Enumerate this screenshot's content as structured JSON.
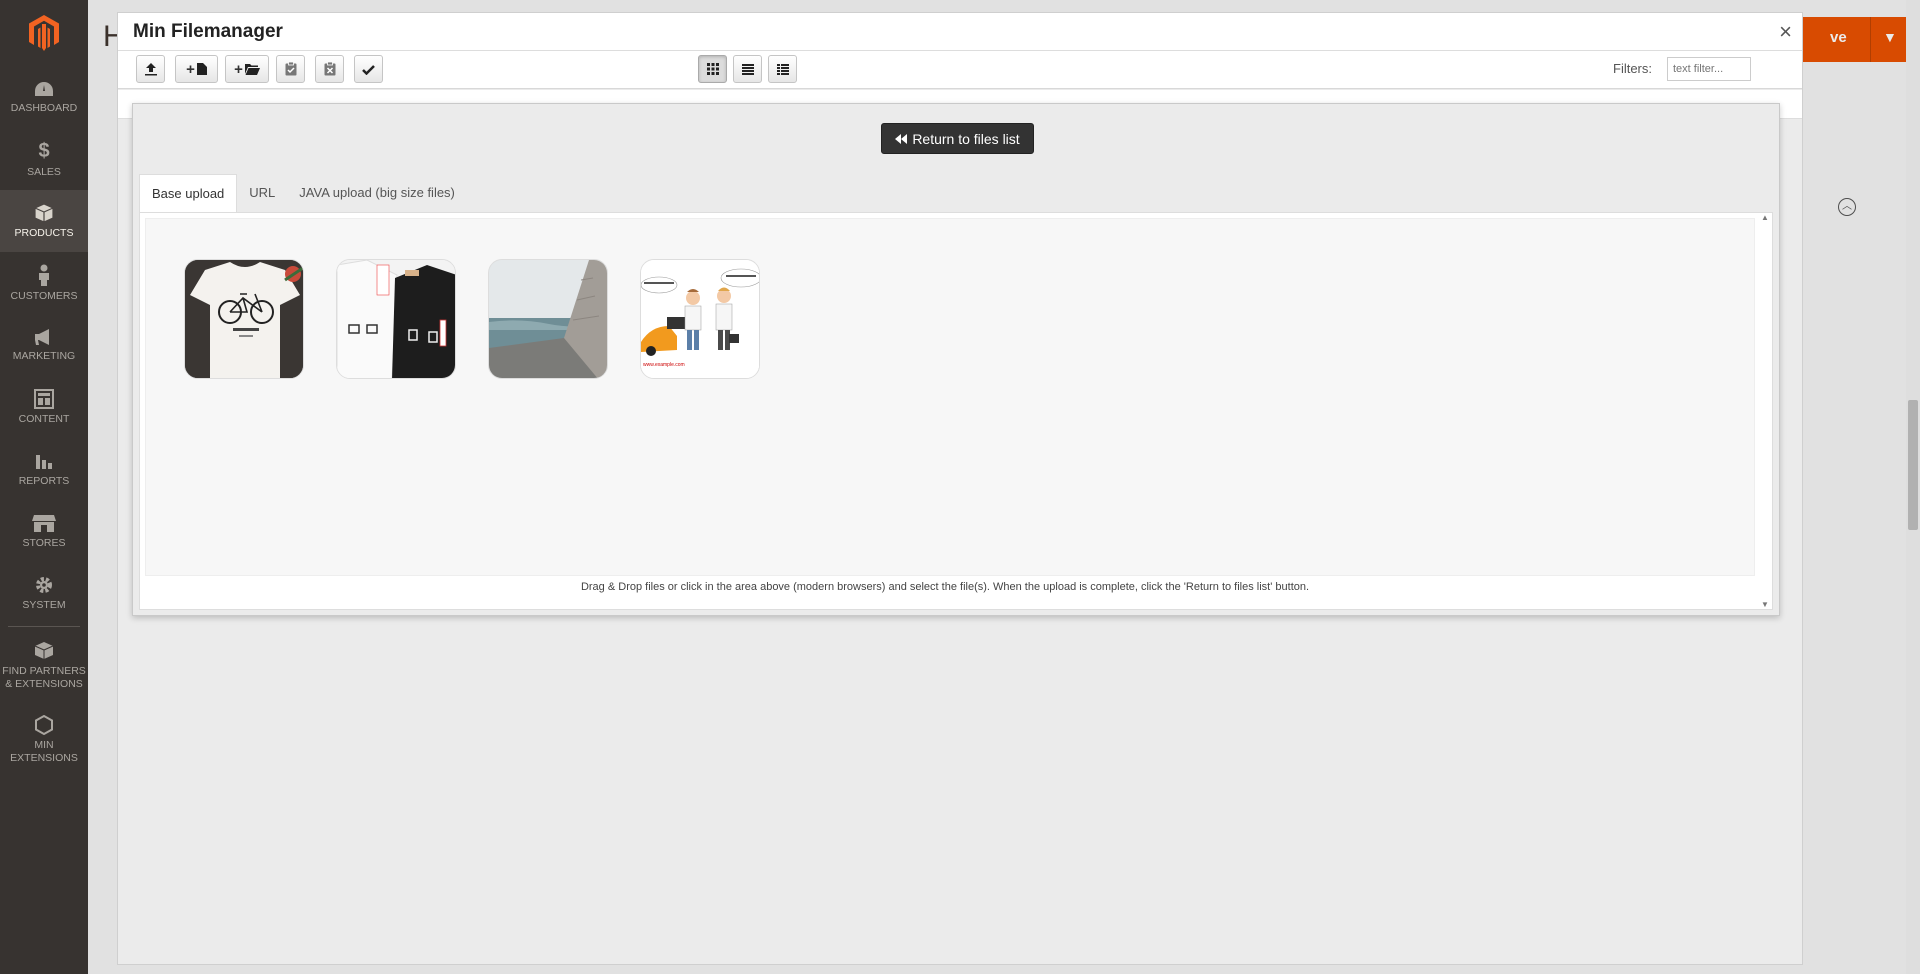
{
  "sidebar": {
    "items": [
      {
        "label": "DASHBOARD",
        "icon": "speedometer-icon"
      },
      {
        "label": "SALES",
        "icon": "dollar-icon"
      },
      {
        "label": "PRODUCTS",
        "icon": "box-icon"
      },
      {
        "label": "CUSTOMERS",
        "icon": "person-icon"
      },
      {
        "label": "MARKETING",
        "icon": "megaphone-icon"
      },
      {
        "label": "CONTENT",
        "icon": "layout-icon"
      },
      {
        "label": "REPORTS",
        "icon": "bar-chart-icon"
      },
      {
        "label": "STORES",
        "icon": "storefront-icon"
      },
      {
        "label": "SYSTEM",
        "icon": "gear-icon"
      },
      {
        "label": "FIND PARTNERS & EXTENSIONS",
        "icon": "cubes-icon"
      },
      {
        "label": "MIN EXTENSIONS",
        "icon": "hexagon-icon"
      }
    ],
    "active": "PRODUCTS"
  },
  "background": {
    "heading_letter": "H",
    "save_label": "ve"
  },
  "modal": {
    "title": "Min Filemanager",
    "close": "×",
    "filters_label": "Filters:",
    "filter_placeholder": "text filter...",
    "return_label": "Return to files list",
    "tabs": [
      {
        "label": "Base upload",
        "active": true
      },
      {
        "label": "URL",
        "active": false
      },
      {
        "label": "JAVA upload (big size files)",
        "active": false
      }
    ],
    "hint": "Drag & Drop files or click in the area above (modern browsers) and select the file(s). When the upload is complete, click the 'Return to files list' button.",
    "thumbnails": [
      {
        "name": "tshirt-bicycle"
      },
      {
        "name": "tshirts-pair"
      },
      {
        "name": "sea-wall"
      },
      {
        "name": "cartoon-business",
        "caption": "www.example.com"
      }
    ]
  },
  "colors": {
    "sidebar_bg": "#373330",
    "accent": "#eb5202",
    "return_btn_bg": "#333333"
  }
}
